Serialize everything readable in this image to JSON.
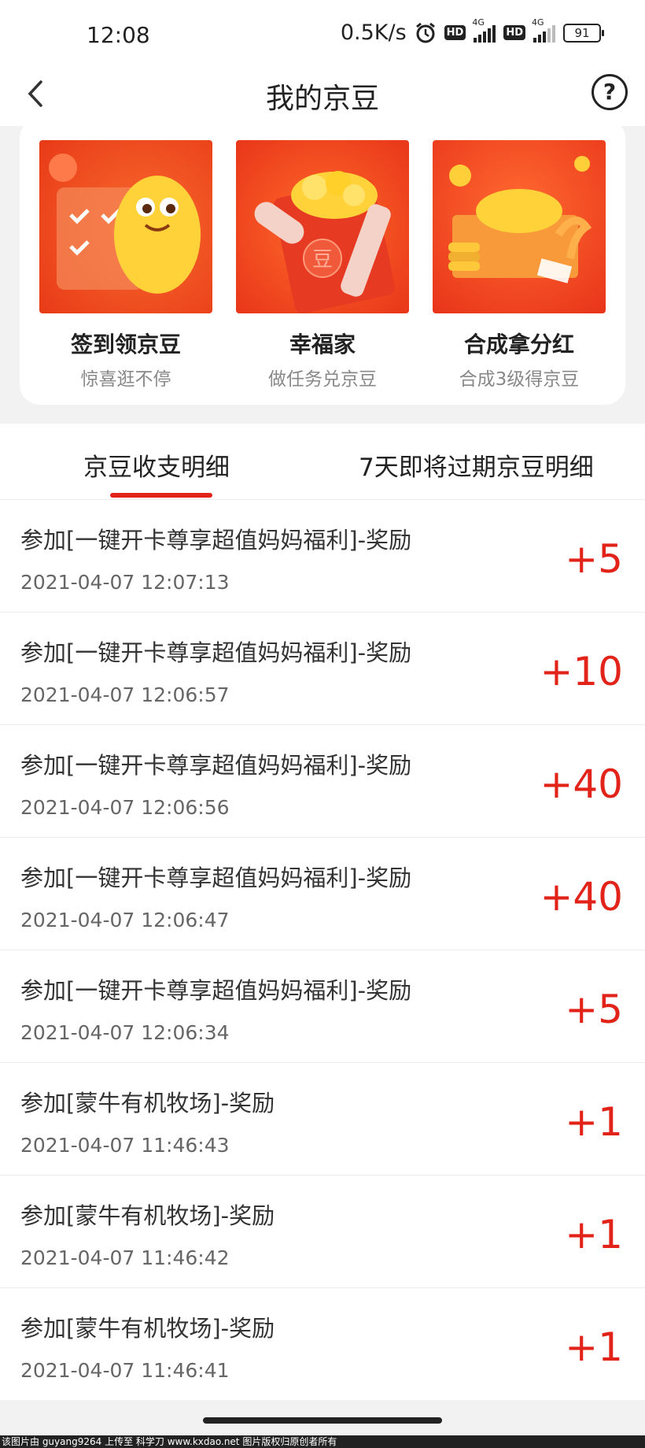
{
  "status_bar": {
    "time": "12:08",
    "speed": "0.5K/s",
    "network1": "4G",
    "network2": "4G",
    "hd": "HD",
    "battery": "91"
  },
  "header": {
    "title": "我的京豆",
    "back_icon": "chevron-left-icon",
    "help_icon": "question-circle-icon"
  },
  "features": [
    {
      "name": "签到领京豆",
      "sub": "惊喜逛不停"
    },
    {
      "name": "幸福家",
      "sub": "做任务兑京豆",
      "badge": "豆"
    },
    {
      "name": "合成拿分红",
      "sub": "合成3级得京豆"
    }
  ],
  "tabs": [
    {
      "label": "京豆收支明细",
      "active": true
    },
    {
      "label": "7天即将过期京豆明细",
      "active": false
    }
  ],
  "records": [
    {
      "desc": "参加[一键开卡尊享超值妈妈福利]-奖励",
      "datetime": "2021-04-07 12:07:13",
      "amount": "+5"
    },
    {
      "desc": "参加[一键开卡尊享超值妈妈福利]-奖励",
      "datetime": "2021-04-07 12:06:57",
      "amount": "+10"
    },
    {
      "desc": "参加[一键开卡尊享超值妈妈福利]-奖励",
      "datetime": "2021-04-07 12:06:56",
      "amount": "+40"
    },
    {
      "desc": "参加[一键开卡尊享超值妈妈福利]-奖励",
      "datetime": "2021-04-07 12:06:47",
      "amount": "+40"
    },
    {
      "desc": "参加[一键开卡尊享超值妈妈福利]-奖励",
      "datetime": "2021-04-07 12:06:34",
      "amount": "+5"
    },
    {
      "desc": "参加[蒙牛有机牧场]-奖励",
      "datetime": "2021-04-07 11:46:43",
      "amount": "+1"
    },
    {
      "desc": "参加[蒙牛有机牧场]-奖励",
      "datetime": "2021-04-07 11:46:42",
      "amount": "+1"
    },
    {
      "desc": "参加[蒙牛有机牧场]-奖励",
      "datetime": "2021-04-07 11:46:41",
      "amount": "+1"
    }
  ],
  "watermark": "该图片由 guyang9264 上传至 科学刀 www.kxdao.net 图片版权归原创者所有",
  "colors": {
    "accent": "#e2231a",
    "card_orange": "#f04a1e"
  }
}
